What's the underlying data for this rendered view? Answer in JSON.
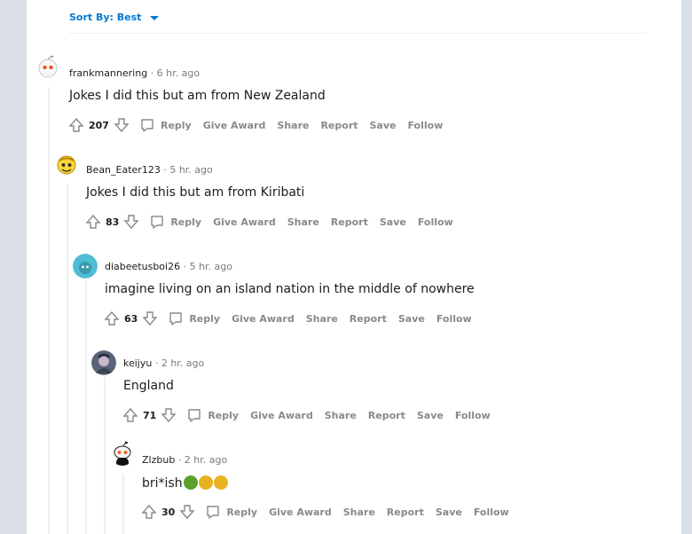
{
  "sort": {
    "label": "Sort By: Best"
  },
  "actions": {
    "reply": "Reply",
    "give_award": "Give Award",
    "share": "Share",
    "report": "Report",
    "save": "Save",
    "follow": "Follow"
  },
  "comments": [
    {
      "user": "frankmannering",
      "time": "· 6 hr. ago",
      "body": "Jokes I did this but am from New Zealand",
      "score": "207"
    },
    {
      "user": "Bean_Eater123",
      "time": "· 5 hr. ago",
      "body": "Jokes I did this but am from Kiribati",
      "score": "83"
    },
    {
      "user": "diabeetusboi26",
      "time": "· 5 hr. ago",
      "body": "imagine living on an island nation in the middle of nowhere",
      "score": "63"
    },
    {
      "user": "keijyu",
      "time": "· 2 hr. ago",
      "body": "England",
      "score": "71"
    },
    {
      "user": "Zlzbub",
      "time": "· 2 hr. ago",
      "body": "bri*ish",
      "score": "30"
    }
  ],
  "colors": {
    "link": "#0079d3",
    "meta": "#787c7e",
    "action": "#878a8c",
    "thread": "#edeff1"
  }
}
